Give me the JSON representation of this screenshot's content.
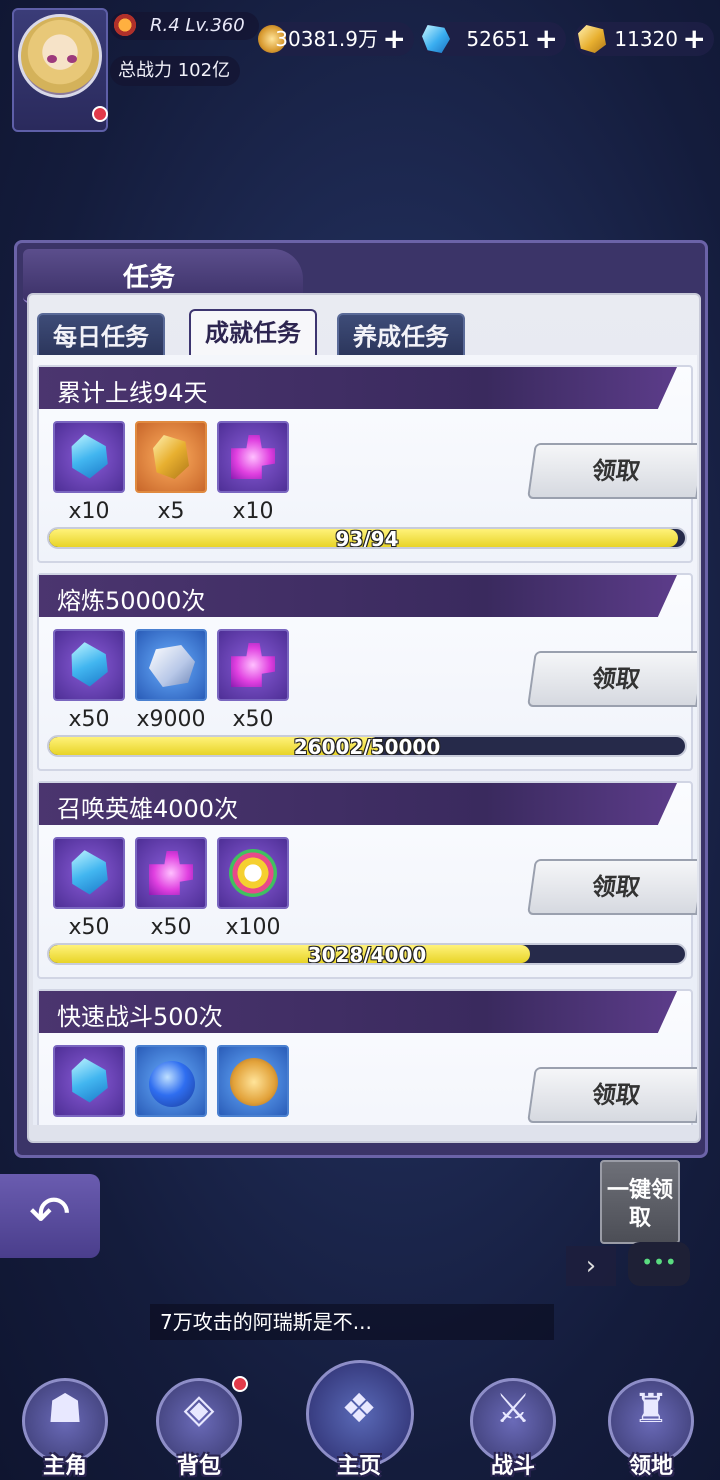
{
  "player": {
    "level_text": "R.4 Lv.360",
    "power_text": "总战力 102亿"
  },
  "resources": [
    {
      "icon": "gold-coin-icon",
      "value": "30381.9万",
      "plus": "+"
    },
    {
      "icon": "blue-diamond-icon",
      "value": "52651",
      "plus": "+"
    },
    {
      "icon": "gold-crystal-icon",
      "value": "11320",
      "plus": "+"
    }
  ],
  "panel": {
    "title": "任务",
    "tabs": [
      "每日任务",
      "成就任务",
      "养成任务"
    ],
    "active_tab": "成就任务"
  },
  "tasks": [
    {
      "title": "累计上线94天",
      "rewards": [
        {
          "icon": "blue-diamond-icon",
          "qty": "x10"
        },
        {
          "icon": "gold-crystal-icon",
          "qty": "x5"
        },
        {
          "icon": "purple-puzzle-icon",
          "qty": "x10"
        }
      ],
      "claim_label": "领取",
      "progress_text": "93/94",
      "progress": 0.9894
    },
    {
      "title": "熔炼50000次",
      "rewards": [
        {
          "icon": "blue-diamond-icon",
          "qty": "x50"
        },
        {
          "icon": "silver-ore-icon",
          "qty": "x9000"
        },
        {
          "icon": "purple-puzzle-icon",
          "qty": "x50"
        }
      ],
      "claim_label": "领取",
      "progress_text": "26002/50000",
      "progress": 0.52
    },
    {
      "title": "召唤英雄4000次",
      "rewards": [
        {
          "icon": "blue-diamond-icon",
          "qty": "x50"
        },
        {
          "icon": "purple-puzzle-icon",
          "qty": "x50"
        },
        {
          "icon": "rainbow-medal-icon",
          "qty": "x100"
        }
      ],
      "claim_label": "领取",
      "progress_text": "3028/4000",
      "progress": 0.757
    },
    {
      "title": "快速战斗500次",
      "rewards": [
        {
          "icon": "blue-diamond-icon",
          "qty": ""
        },
        {
          "icon": "blue-potion-icon",
          "qty": ""
        },
        {
          "icon": "gold-laurel-coin-icon",
          "qty": ""
        }
      ],
      "claim_label": "领取"
    }
  ],
  "oneclick_label": "一键领取",
  "chat_message": "7万攻击的阿瑞斯是不...",
  "nav": [
    {
      "label": "主角",
      "icon": "hero-icon"
    },
    {
      "label": "背包",
      "icon": "bag-icon"
    },
    {
      "label": "主页",
      "icon": "book-icon"
    },
    {
      "label": "战斗",
      "icon": "swords-icon"
    },
    {
      "label": "领地",
      "icon": "castle-icon"
    }
  ]
}
